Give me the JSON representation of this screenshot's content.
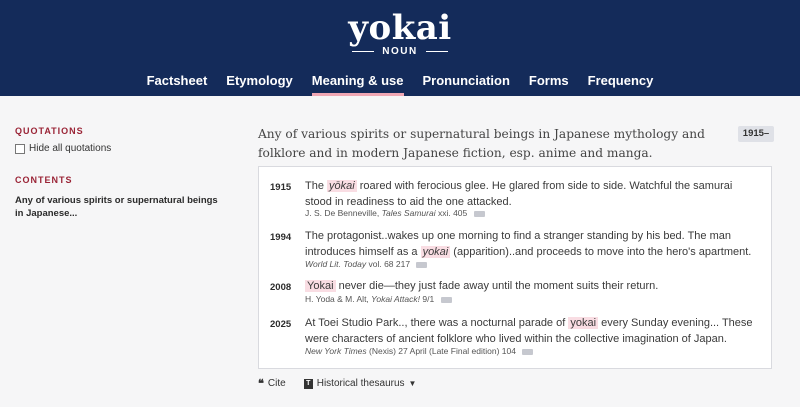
{
  "header": {
    "headword": "yokai",
    "part_of_speech": "NOUN",
    "tabs": [
      "Factsheet",
      "Etymology",
      "Meaning & use",
      "Pronunciation",
      "Forms",
      "Frequency"
    ],
    "active_tab": "Meaning & use"
  },
  "sidebar": {
    "quotations_heading": "QUOTATIONS",
    "hide_quotations_label": "Hide all quotations",
    "contents_heading": "CONTENTS",
    "contents_link": "Any of various spirits or supernatural beings in Japanese..."
  },
  "main": {
    "definition": "Any of various spirits or supernatural beings in Japanese mythology and folklore and in modern Japanese fiction, esp. anime and manga.",
    "date_badge": "1915–",
    "quotations": [
      {
        "year": "1915",
        "pre": "The ",
        "keyword": "yōkai",
        "post": " roared with ferocious glee. He glared from side to side. Watchful the samurai stood in readiness to aid the one attacked.",
        "source_author": "J. S. De Benneville,",
        "source_title": "Tales Samurai",
        "source_ref": "xxi. 405"
      },
      {
        "year": "1994",
        "pre": "The protagonist..wakes up one morning to find a stranger standing by his bed. The man introduces himself as a ",
        "keyword": "yokai",
        "post": " (apparition)..and proceeds to move into the hero's apartment.",
        "source_author": "",
        "source_title": "World Lit. Today",
        "source_ref": "vol. 68 217"
      },
      {
        "year": "2008",
        "pre": "",
        "keyword": "Yokai",
        "post": " never die—they just fade away until the moment suits their return.",
        "source_author": "H. Yoda & M. Alt,",
        "source_title": "Yokai Attack!",
        "source_ref": "9/1"
      },
      {
        "year": "2025",
        "pre": "At Toei Studio Park.., there was a nocturnal parade of ",
        "keyword": "yokai",
        "post": " every Sunday evening... These were characters of ancient folklore who lived within the collective imagination of Japan.",
        "source_author": "",
        "source_title": "New York Times",
        "source_ref": "(Nexis) 27 April (Late Final edition) 104"
      }
    ]
  },
  "actions": {
    "cite_label": "Cite",
    "thesaurus_label": "Historical thesaurus"
  },
  "colors": {
    "header_bg": "#142b5a",
    "accent": "#9a2436",
    "highlight": "#f9dde3",
    "active_tab_underline": "#f0a7b4"
  }
}
